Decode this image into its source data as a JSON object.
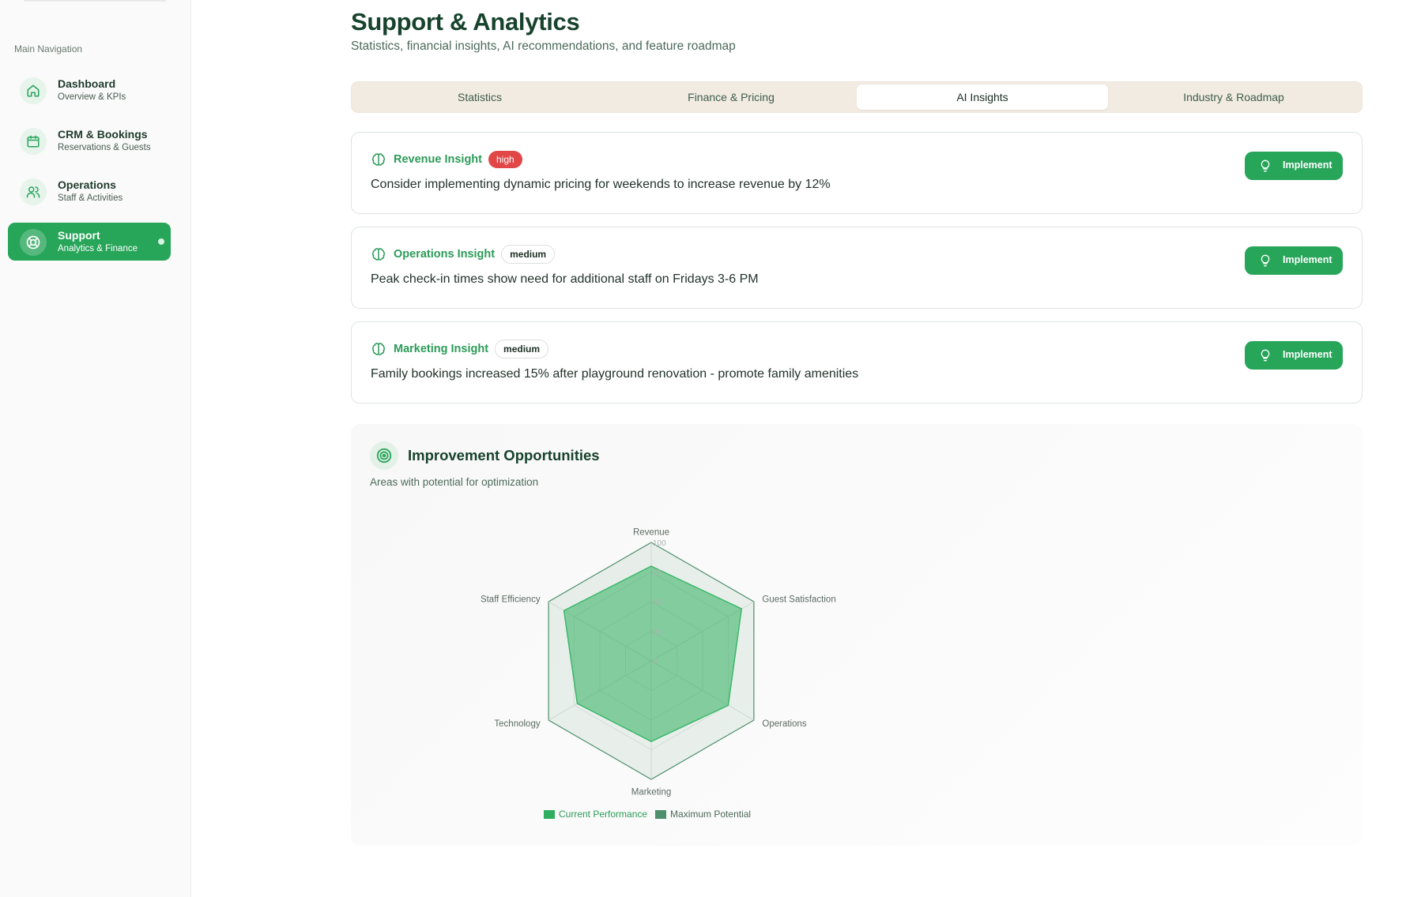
{
  "sidebar": {
    "heading": "Main Navigation",
    "items": [
      {
        "title": "Dashboard",
        "subtitle": "Overview & KPIs",
        "icon": "home-icon",
        "active": false
      },
      {
        "title": "CRM & Bookings",
        "subtitle": "Reservations & Guests",
        "icon": "calendar-icon",
        "active": false
      },
      {
        "title": "Operations",
        "subtitle": "Staff & Activities",
        "icon": "users-icon",
        "active": false
      },
      {
        "title": "Support",
        "subtitle": "Analytics & Finance",
        "icon": "lifebuoy-icon",
        "active": true
      }
    ]
  },
  "header": {
    "title": "Support & Analytics",
    "subtitle": "Statistics, financial insights, AI recommendations, and feature roadmap"
  },
  "tabs": [
    {
      "label": "Statistics",
      "active": false
    },
    {
      "label": "Finance & Pricing",
      "active": false
    },
    {
      "label": "AI Insights",
      "active": true
    },
    {
      "label": "Industry & Roadmap",
      "active": false
    }
  ],
  "insights": [
    {
      "title": "Revenue Insight",
      "priority": "high",
      "text": "Consider implementing dynamic pricing for weekends to increase revenue by 12%",
      "button": "Implement"
    },
    {
      "title": "Operations Insight",
      "priority": "medium",
      "text": "Peak check-in times show need for additional staff on Fridays 3-6 PM",
      "button": "Implement"
    },
    {
      "title": "Marketing Insight",
      "priority": "medium",
      "text": "Family bookings increased 15% after playground renovation - promote family amenities",
      "button": "Implement"
    }
  ],
  "improvement": {
    "title": "Improvement Opportunities",
    "subtitle": "Areas with potential for optimization"
  },
  "colors": {
    "accent": "#27a559",
    "high_badge": "#e24748",
    "current_fill": "#3cb86a",
    "maximum_fill": "#4f8f6d"
  },
  "chart_data": {
    "type": "radar",
    "categories": [
      "Revenue",
      "Guest Satisfaction",
      "Operations",
      "Marketing",
      "Technology",
      "Staff Efficiency"
    ],
    "series": [
      {
        "name": "Current Performance",
        "values": [
          80,
          88,
          75,
          68,
          72,
          85
        ]
      },
      {
        "name": "Maximum Potential",
        "values": [
          100,
          100,
          100,
          100,
          100,
          100
        ]
      }
    ],
    "radial_ticks": [
      "0",
      "25",
      "50",
      "75",
      "100"
    ],
    "rlim": [
      0,
      100
    ],
    "grid": true,
    "legend_position": "bottom"
  }
}
